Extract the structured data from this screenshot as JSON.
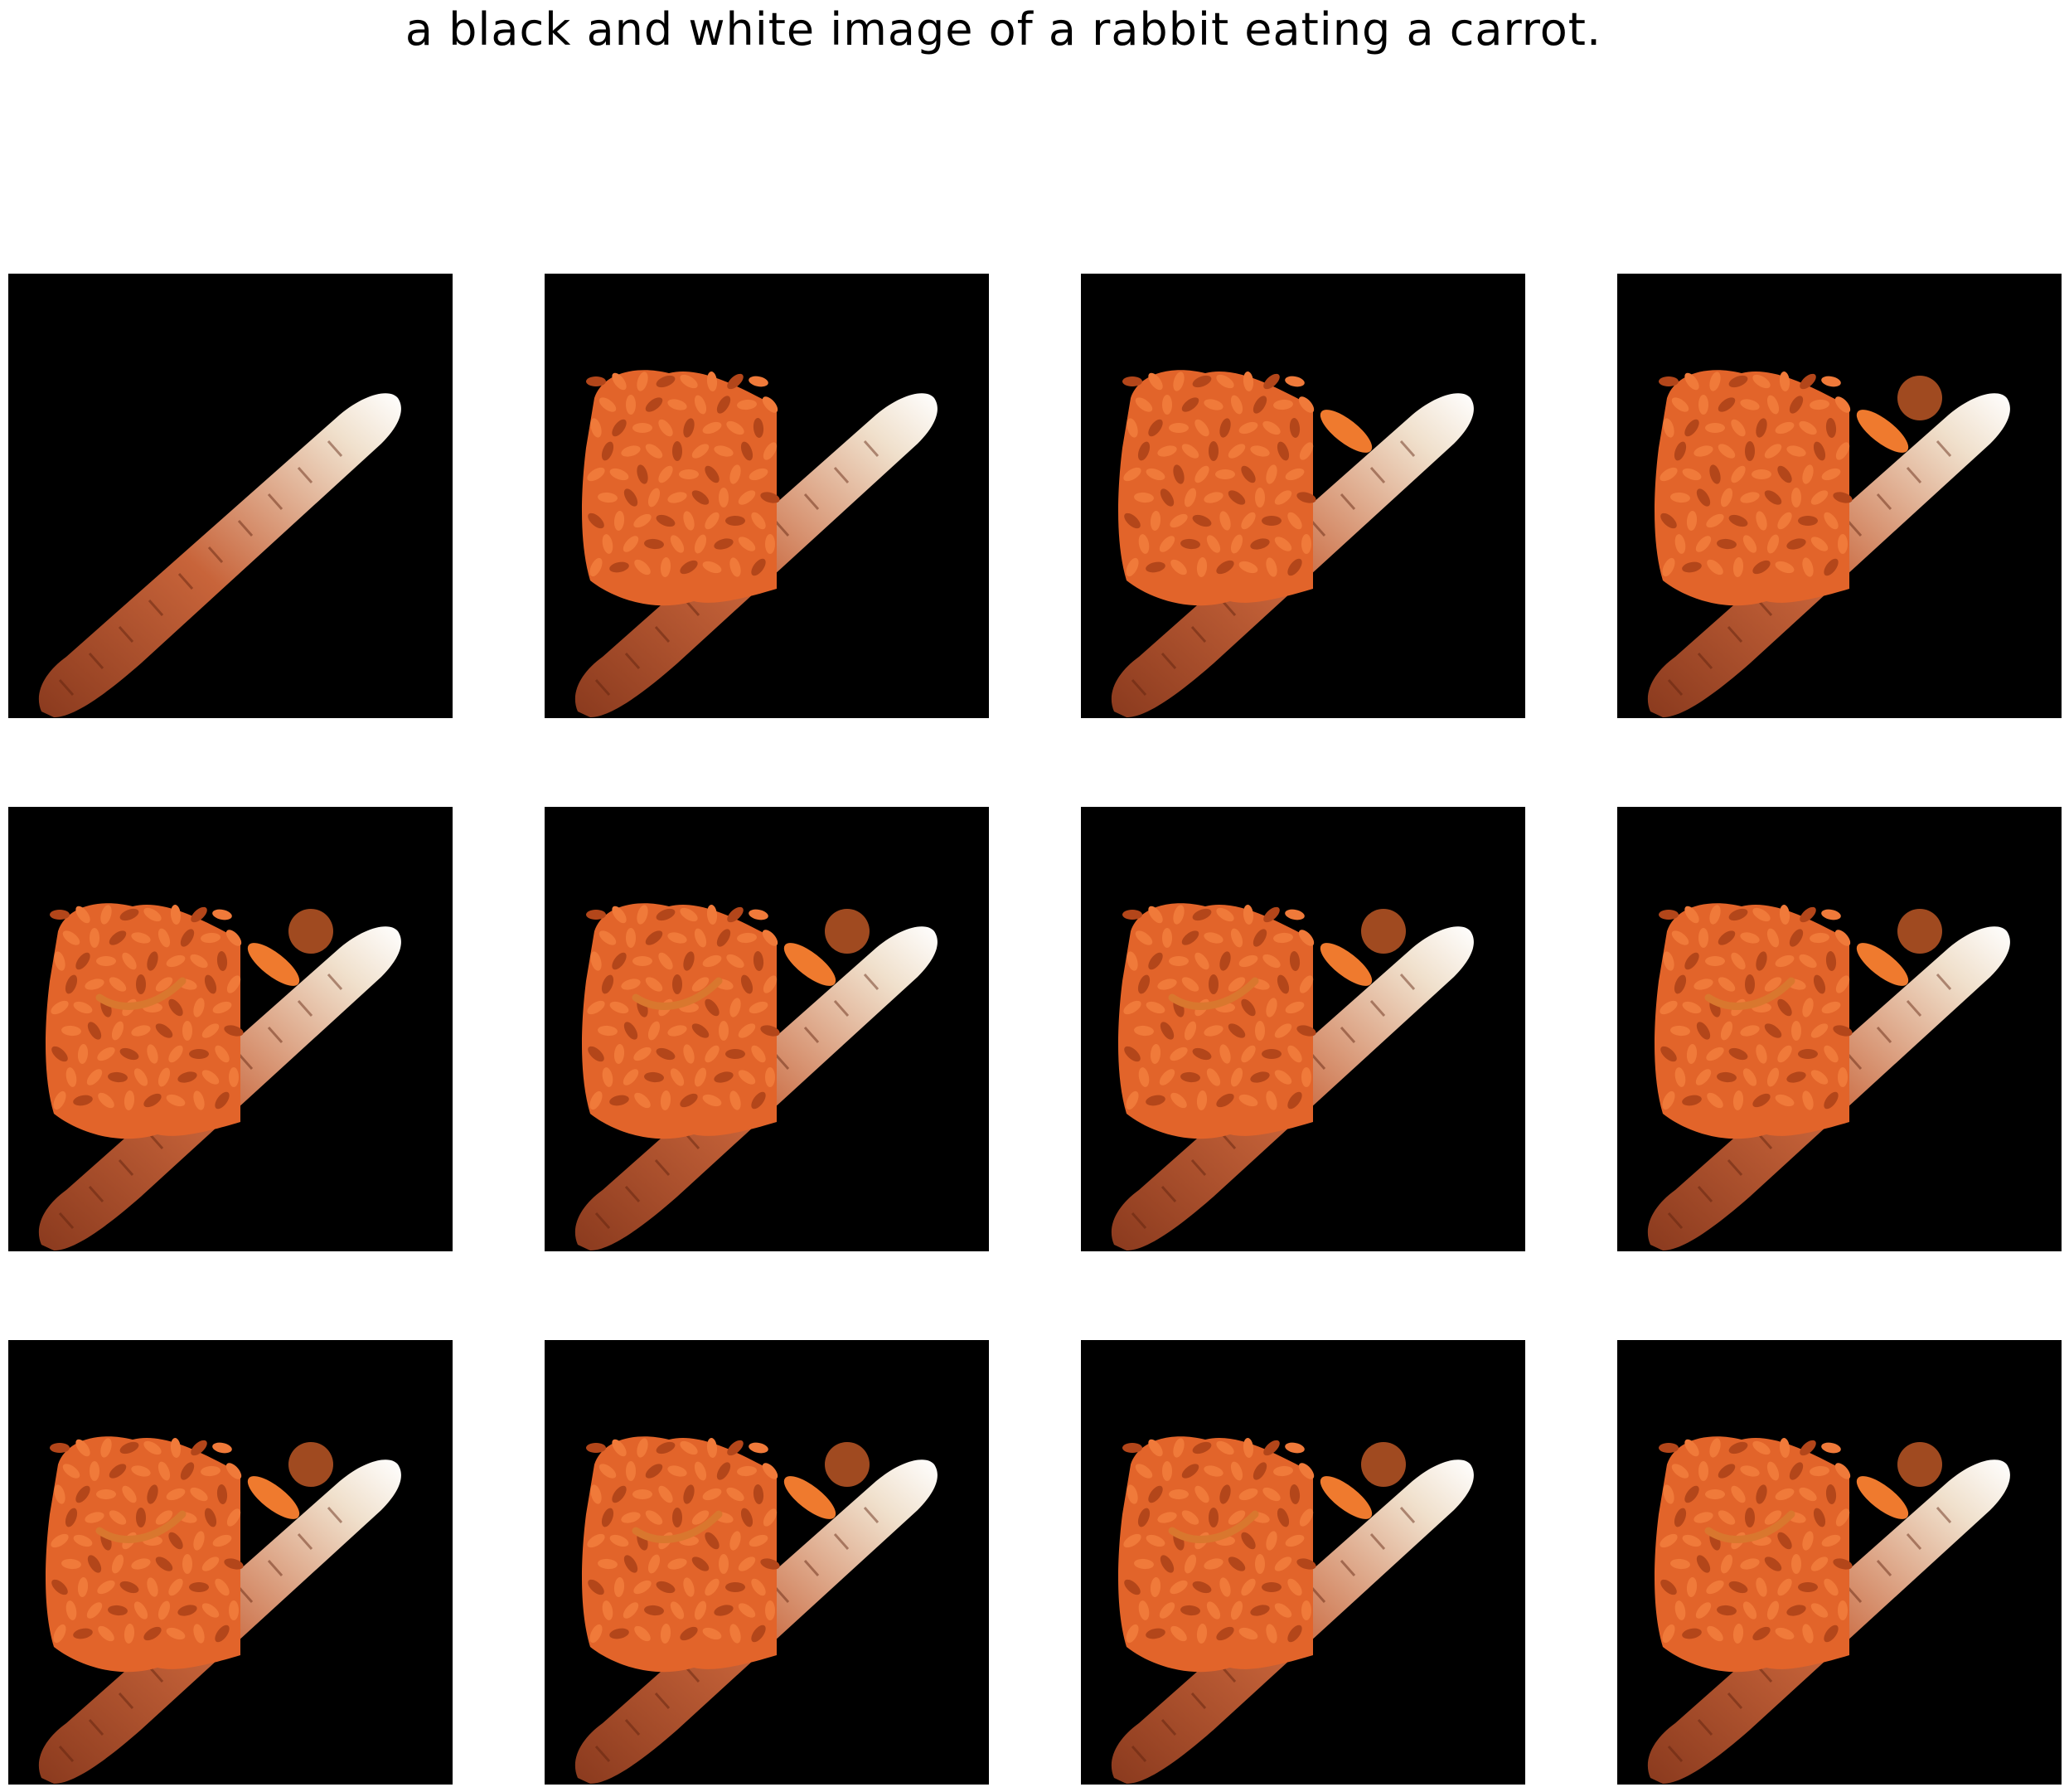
{
  "figure": {
    "title": "a black and white image of a rabbit eating a carrot."
  },
  "panels": [
    {
      "stage": 0
    },
    {
      "stage": 1
    },
    {
      "stage": 2
    },
    {
      "stage": 3
    },
    {
      "stage": 4
    },
    {
      "stage": 4
    },
    {
      "stage": 4
    },
    {
      "stage": 4
    },
    {
      "stage": 4
    },
    {
      "stage": 4
    },
    {
      "stage": 4
    },
    {
      "stage": 4
    }
  ],
  "colors": {
    "background": "#000000",
    "carrot_dark": "#8a3a1e",
    "carrot_mid": "#c8643a",
    "carrot_light": "#f0e0cc",
    "cluster": "#e2642a",
    "cluster_dark": "#b3461a",
    "slice": "#ef7a2e",
    "ball": "#a04a20"
  }
}
